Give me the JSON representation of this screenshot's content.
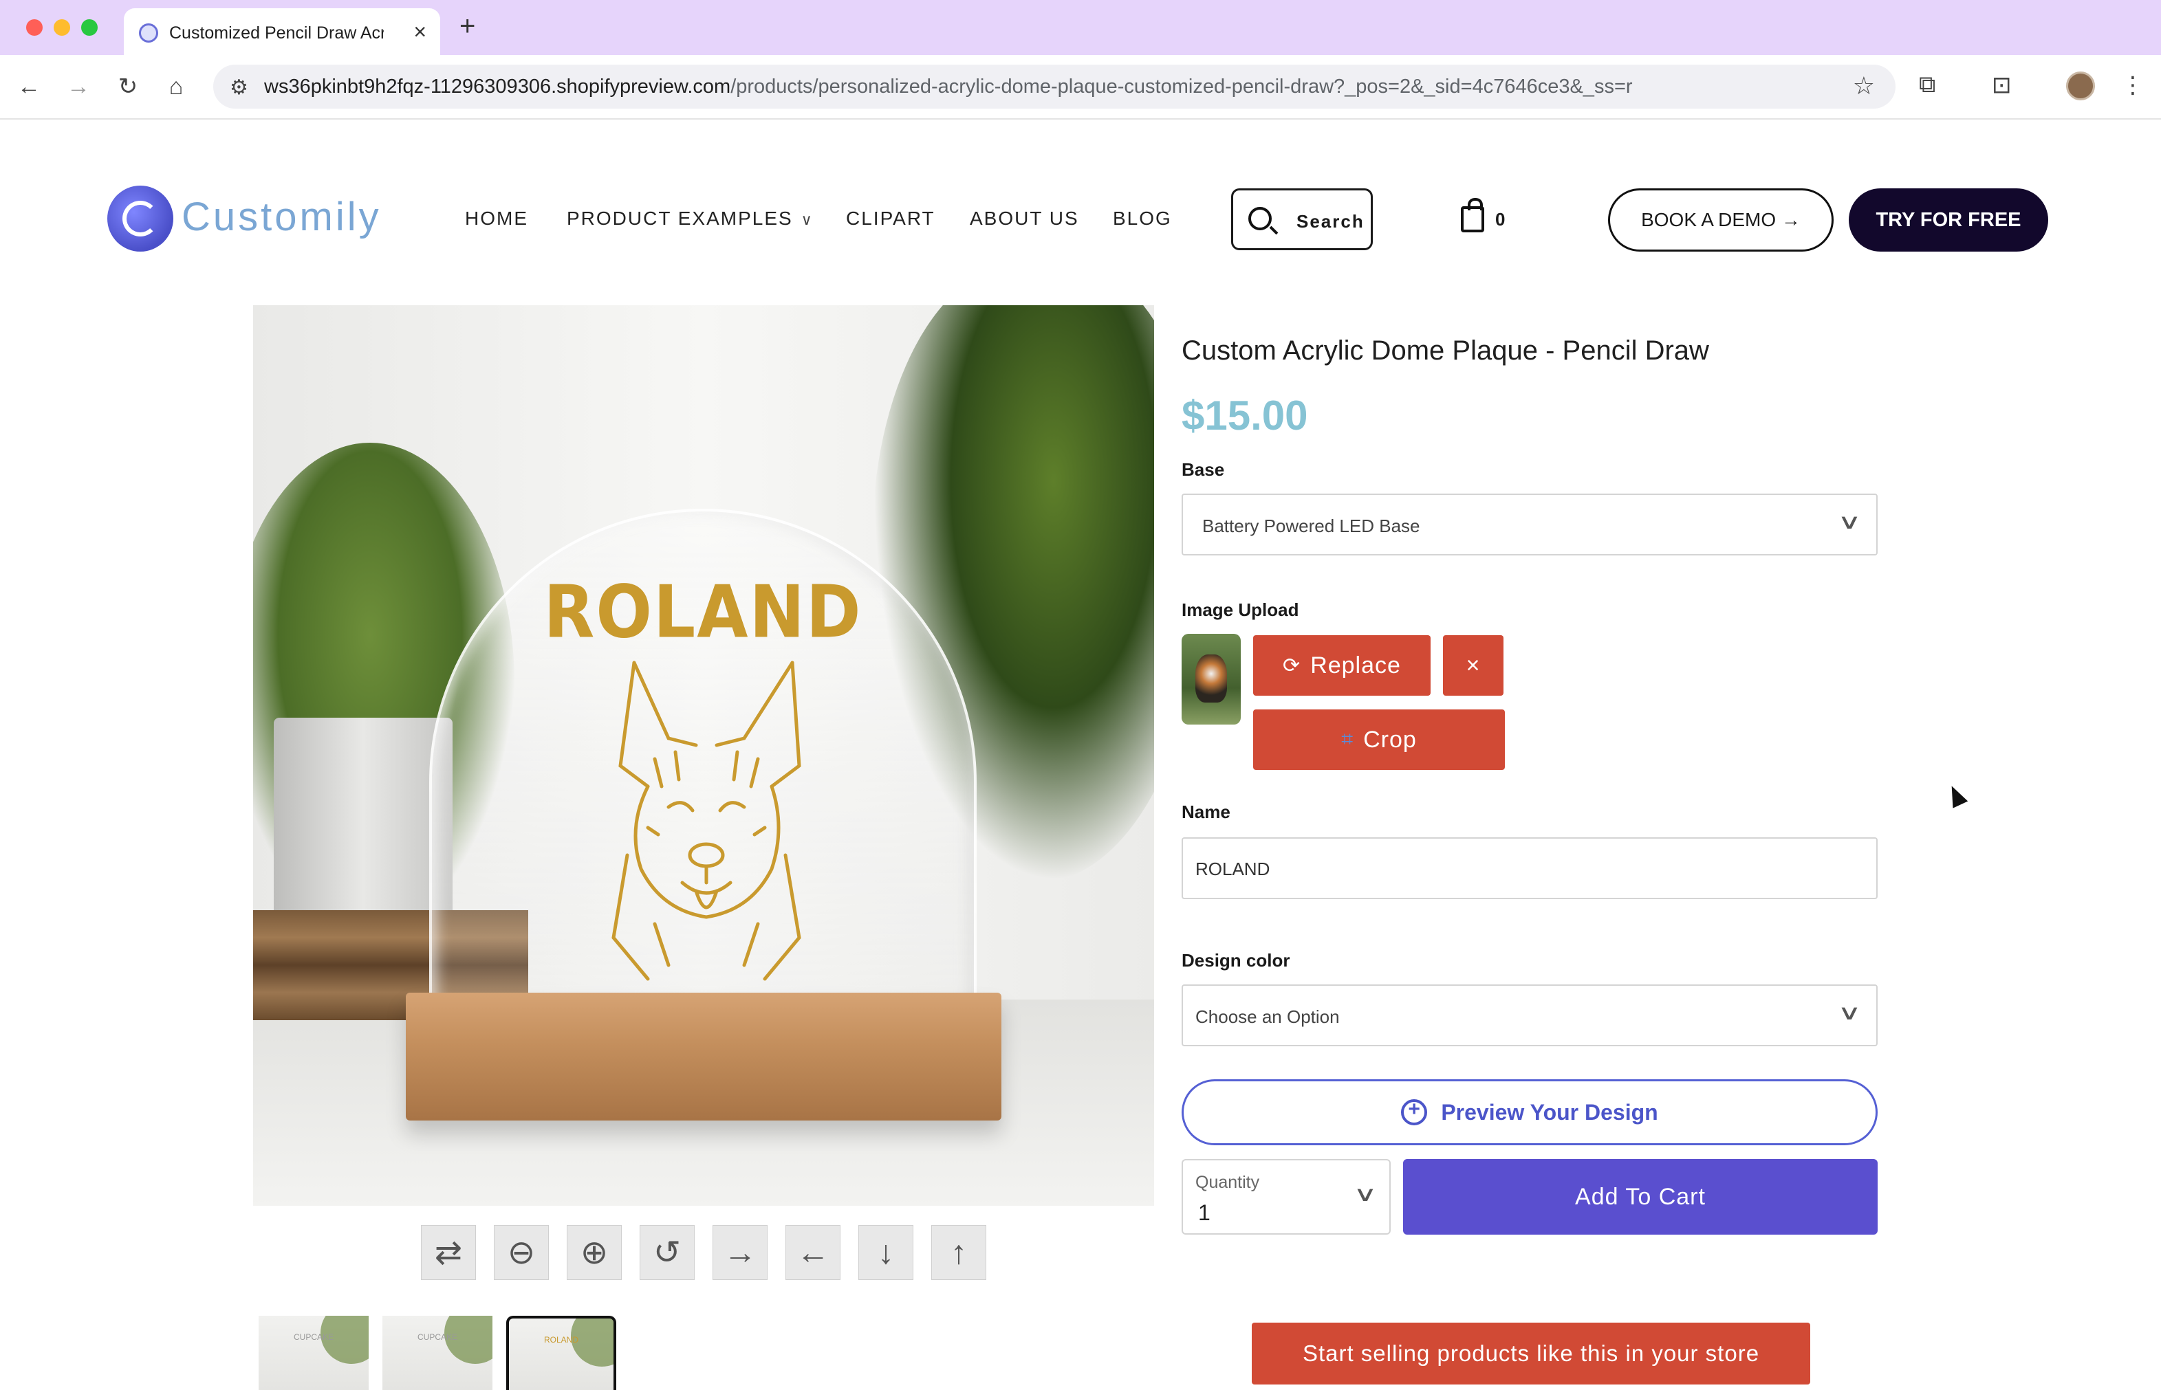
{
  "browser": {
    "tab_title": "Customized Pencil Draw Acry",
    "url_host": "ws36pkinbt9h2fqz-11296309306.shopifypreview.com",
    "url_path": "/products/personalized-acrylic-dome-plaque-customized-pencil-draw?_pos=2&_sid=4c7646ce3&_ss=r"
  },
  "header": {
    "logo_text": "Customily",
    "nav": [
      "HOME",
      "PRODUCT EXAMPLES",
      "CLIPART",
      "ABOUT US",
      "BLOG"
    ],
    "search_label": "Search",
    "cart_count": "0",
    "demo_label": "BOOK A DEMO →",
    "try_label": "TRY FOR FREE"
  },
  "product": {
    "title": "Custom Acrylic Dome Plaque - Pencil Draw",
    "price": "$15.00",
    "preview_name": "ROLAND",
    "thumbnail_labels": [
      "CUPCAKE",
      "CUPCAKE",
      "ROLAND"
    ]
  },
  "form": {
    "base_label": "Base",
    "base_value": "Battery Powered LED Base",
    "upload_label": "Image Upload",
    "replace_label": "Replace",
    "remove_label": "×",
    "crop_label": "Crop",
    "name_label": "Name",
    "name_value": "ROLAND",
    "color_label": "Design color",
    "color_value": "Choose an Option",
    "preview_label": "Preview Your Design",
    "quantity_label": "Quantity",
    "quantity_value": "1",
    "add_to_cart_label": "Add To Cart",
    "sell_label": "Start selling products like this in your store"
  },
  "colors": {
    "price": "#86c3d4",
    "action_red": "#d14a35",
    "cart_purple": "#5a4fcf",
    "preview_blue": "#4b55c9",
    "try_button": "#12082c",
    "tab_strip": "#e6d4fb"
  },
  "icons": {
    "tools": [
      "swap-icon",
      "zoom-out-icon",
      "zoom-in-icon",
      "rotate-icon",
      "arrow-right-icon",
      "arrow-left-icon",
      "arrow-down-icon",
      "arrow-up-icon"
    ]
  }
}
